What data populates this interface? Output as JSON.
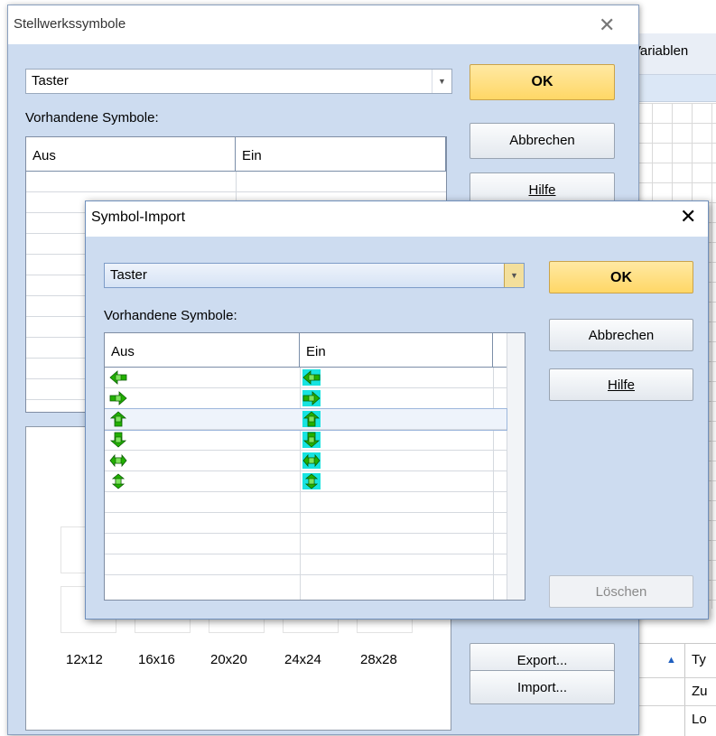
{
  "background_app": {
    "tab_label": "Variablen",
    "table_header_sort": "▲",
    "table_header_col": "Ty",
    "table_rows": [
      "Zu",
      "Lo"
    ]
  },
  "outer_dialog": {
    "title": "Stellwerkssymbole",
    "close_glyph": "✕",
    "combo_value": "Taster",
    "list_label": "Vorhandene Symbole:",
    "columns": [
      "Aus",
      "Ein"
    ],
    "buttons": {
      "ok": "OK",
      "cancel": "Abbrechen",
      "help": "Hilfe",
      "export": "Export...",
      "import": "Import..."
    },
    "sizes": [
      "12x12",
      "16x16",
      "20x20",
      "24x24",
      "28x28"
    ]
  },
  "inner_dialog": {
    "title": "Symbol-Import",
    "close_glyph": "✕",
    "combo_value": "Taster",
    "list_label": "Vorhandene Symbole:",
    "columns": [
      "Aus",
      "Ein"
    ],
    "buttons": {
      "ok": "OK",
      "cancel": "Abbrechen",
      "help": "Hilfe",
      "delete": "Löschen"
    },
    "rows": [
      {
        "off": "arrow-left-icon",
        "on": "arrow-left-icon"
      },
      {
        "off": "arrow-right-icon",
        "on": "arrow-right-icon"
      },
      {
        "off": "arrow-up-icon",
        "on": "arrow-up-icon"
      },
      {
        "off": "arrow-down-icon",
        "on": "arrow-down-icon"
      },
      {
        "off": "arrow-left-right-icon",
        "on": "arrow-left-right-icon"
      },
      {
        "off": "arrow-up-down-icon",
        "on": "arrow-up-down-icon"
      }
    ],
    "selected_row": 2
  },
  "colors": {
    "dialog_bg": "#cddcf0",
    "ok_button": "#ffd766",
    "symbol_green": "#22b000",
    "symbol_on_bg": "#17e3e0"
  }
}
